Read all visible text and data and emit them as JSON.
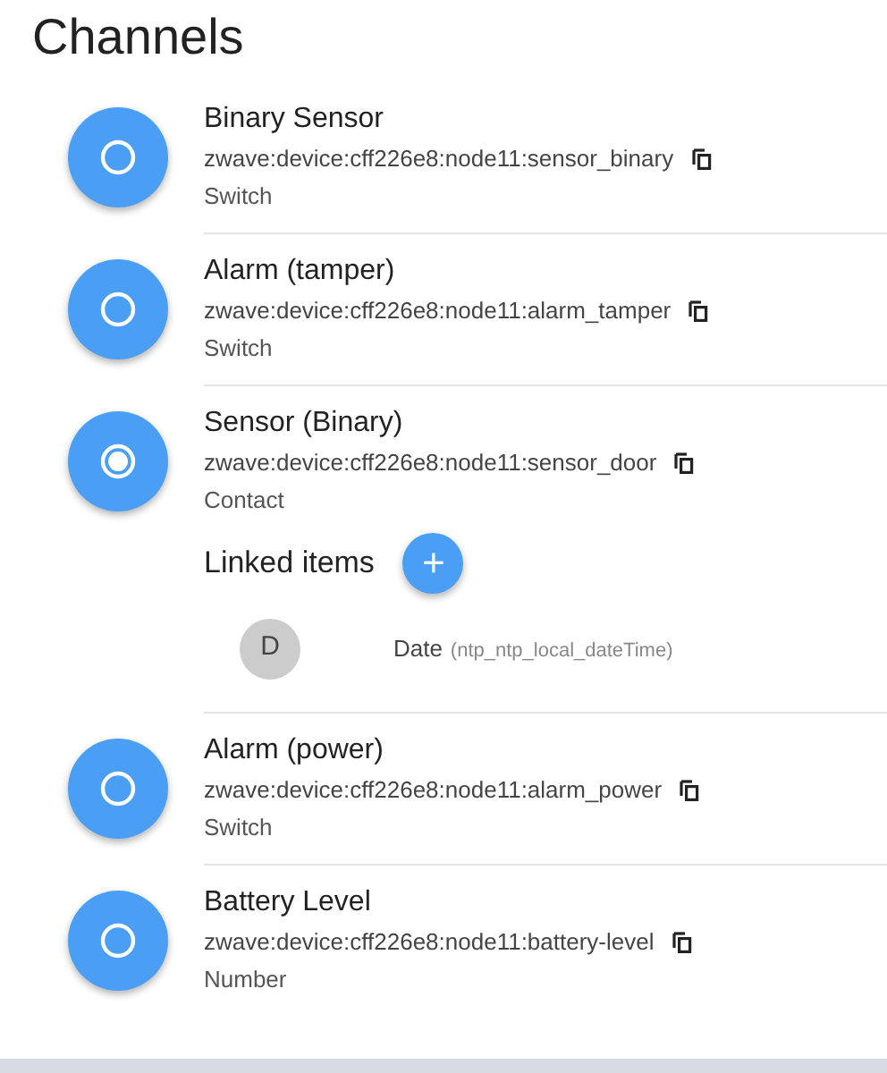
{
  "title": "Channels",
  "channels": [
    {
      "label": "Binary Sensor",
      "uid": "zwave:device:cff226e8:node11:sensor_binary",
      "type": "Switch",
      "selected": false
    },
    {
      "label": "Alarm (tamper)",
      "uid": "zwave:device:cff226e8:node11:alarm_tamper",
      "type": "Switch",
      "selected": false
    },
    {
      "label": "Sensor (Binary)",
      "uid": "zwave:device:cff226e8:node11:sensor_door",
      "type": "Contact",
      "selected": true,
      "linked_heading": "Linked items",
      "add_button": "+",
      "linked_items": [
        {
          "initial": "D",
          "label": "Date",
          "name": "(ntp_ntp_local_dateTime)"
        }
      ]
    },
    {
      "label": "Alarm (power)",
      "uid": "zwave:device:cff226e8:node11:alarm_power",
      "type": "Switch",
      "selected": false
    },
    {
      "label": "Battery Level",
      "uid": "zwave:device:cff226e8:node11:battery-level",
      "type": "Number",
      "selected": false
    }
  ]
}
